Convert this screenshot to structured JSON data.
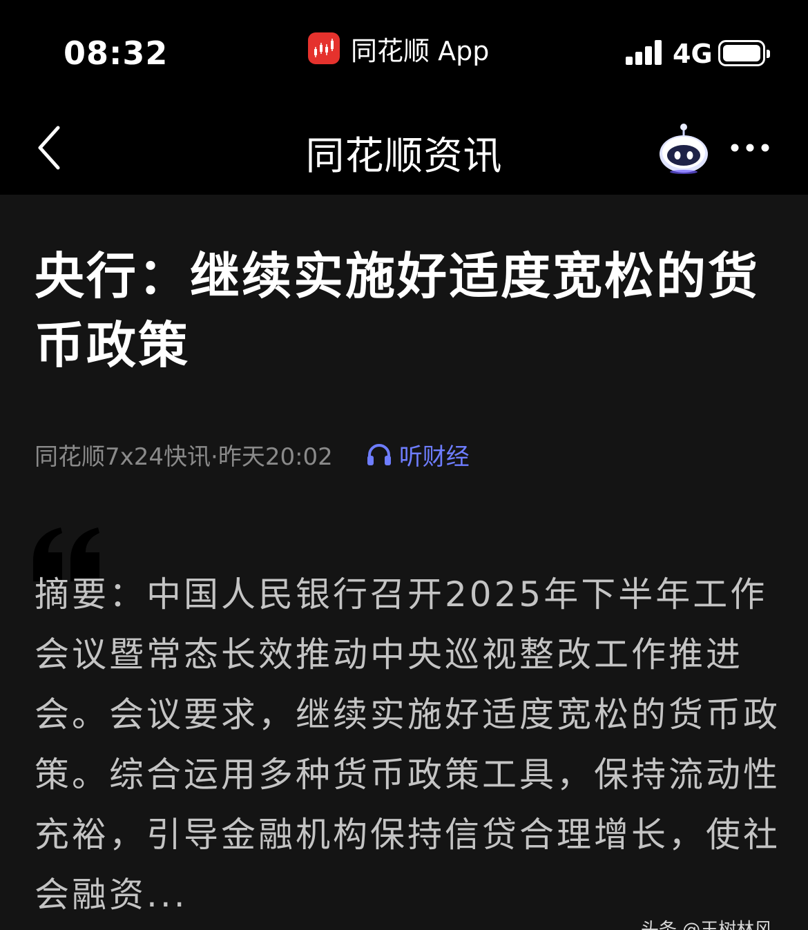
{
  "status_bar": {
    "time": "08:32",
    "app_name": "同花顺 App",
    "network": "4G"
  },
  "nav": {
    "title": "同花顺资讯",
    "icons": [
      "back-icon",
      "robot-assistant-icon",
      "more-icon"
    ]
  },
  "article": {
    "title": "央行：继续实施好适度宽松的货币政策",
    "source_time": "同花顺7x24快讯·昨天20:02",
    "listen_label": "听财经",
    "summary": "摘要：中国人民银行召开2025年下半年工作会议暨常态长效推动中央巡视整改工作推进会。会议要求，继续实施好适度宽松的货币政策。综合运用多种货币政策工具，保持流动性充裕，引导金融机构保持信贷合理增长，使社会融资..."
  },
  "watermark": "头条 @王树林风",
  "colors": {
    "background": "#141414",
    "bar": "#000000",
    "accent_blue": "#6e7dff",
    "app_red": "#e5322d"
  }
}
